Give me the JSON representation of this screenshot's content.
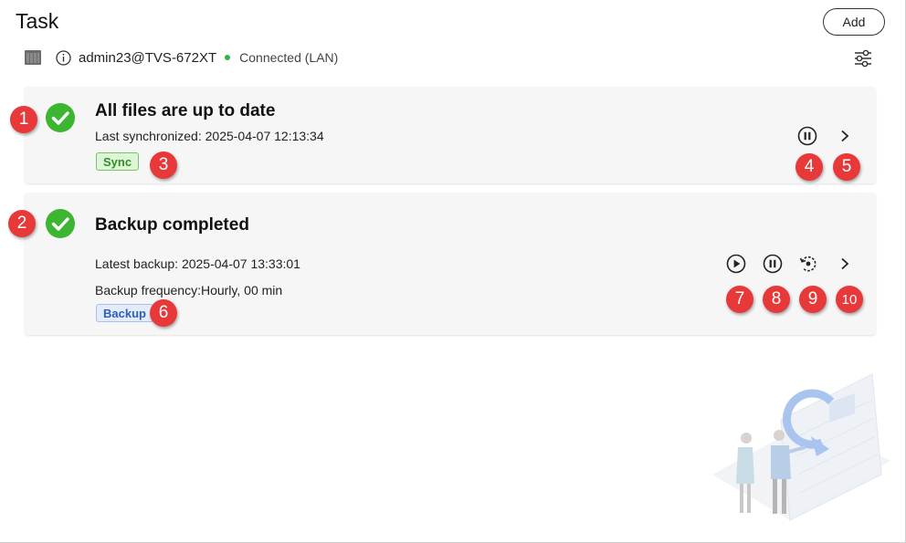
{
  "header": {
    "title": "Task",
    "add_label": "Add",
    "account": "admin23@TVS-672XT",
    "connection": "Connected (LAN)",
    "status_color": "#2db34a"
  },
  "tasks": [
    {
      "title": "All files are up to date",
      "line1": "Last synchronized: 2025-04-07 12:13:34",
      "tag": "Sync",
      "status_icon": "check-circle-icon",
      "actions": [
        "pause-icon",
        "chevron-right-icon"
      ]
    },
    {
      "title": "Backup completed",
      "line1": "Latest backup: 2025-04-07 13:33:01",
      "line2": "Backup frequency:Hourly, 00 min",
      "tag": "Backup",
      "status_icon": "check-circle-icon",
      "actions": [
        "play-icon",
        "pause-icon",
        "restore-icon",
        "chevron-right-icon"
      ]
    }
  ],
  "badges": [
    "1",
    "2",
    "3",
    "4",
    "5",
    "6",
    "7",
    "8",
    "9",
    "10"
  ],
  "colors": {
    "success": "#3cb531",
    "badge": "#e8393a",
    "sync_tag": "#2f8f25",
    "backup_tag": "#2f5db8"
  }
}
